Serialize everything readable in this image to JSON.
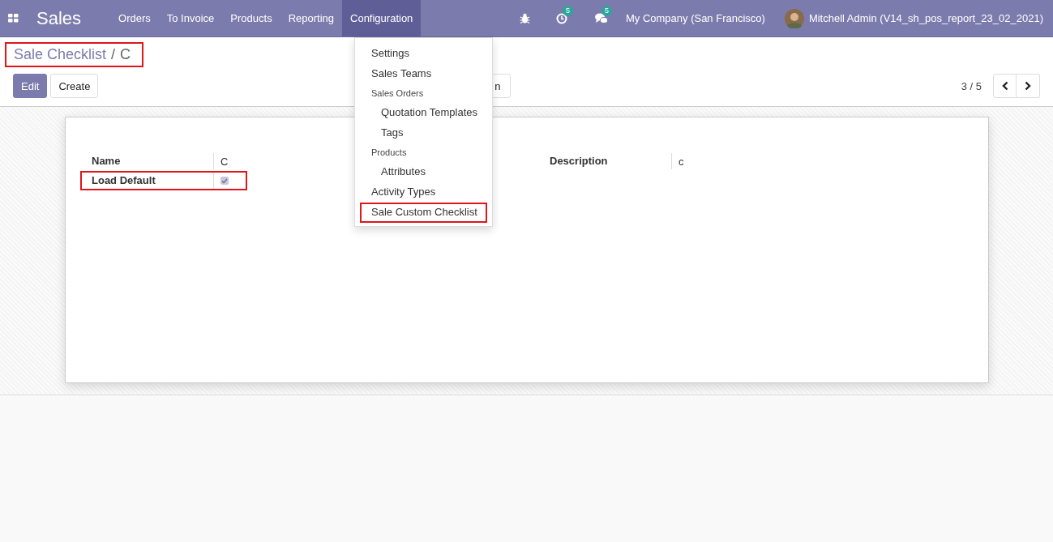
{
  "navbar": {
    "app_title": "Sales",
    "menu": [
      {
        "label": "Orders",
        "selected": false
      },
      {
        "label": "To Invoice",
        "selected": false
      },
      {
        "label": "Products",
        "selected": false
      },
      {
        "label": "Reporting",
        "selected": false
      },
      {
        "label": "Configuration",
        "selected": true
      }
    ],
    "activity_count": "5",
    "message_count": "5",
    "company": "My Company (San Francisco)",
    "user": "Mitchell Admin (V14_sh_pos_report_23_02_2021)"
  },
  "breadcrumb": {
    "items": [
      "Sale Checklist",
      "C"
    ],
    "separator": "/",
    "highlighted": true
  },
  "buttons": [
    {
      "label": "Edit",
      "kind": "primary"
    },
    {
      "label": "Create",
      "kind": "secondary"
    }
  ],
  "hidden_button": {
    "label": "n"
  },
  "pager": {
    "text": "3 / 5"
  },
  "form": {
    "left": [
      {
        "label": "Name",
        "kind": "text",
        "value": "C",
        "highlighted": false
      },
      {
        "label": "Load Default",
        "kind": "checkbox",
        "checked": true,
        "highlighted": true
      }
    ],
    "right": [
      {
        "label": "Description",
        "kind": "text",
        "value": "c",
        "highlighted": false
      }
    ]
  },
  "dropdown": {
    "items": [
      {
        "label": "Settings",
        "kind": "item",
        "highlighted": false
      },
      {
        "label": "Sales Teams",
        "kind": "item",
        "highlighted": false
      },
      {
        "label": "Sales Orders",
        "kind": "header",
        "highlighted": false
      },
      {
        "label": "Quotation Templates",
        "kind": "subitem",
        "highlighted": false
      },
      {
        "label": "Tags",
        "kind": "subitem",
        "highlighted": false
      },
      {
        "label": "Products",
        "kind": "header",
        "highlighted": false
      },
      {
        "label": "Attributes",
        "kind": "subitem",
        "highlighted": false
      },
      {
        "label": "Activity Types",
        "kind": "item",
        "highlighted": false
      },
      {
        "label": "Sale Custom Checklist",
        "kind": "item",
        "highlighted": true
      }
    ]
  }
}
